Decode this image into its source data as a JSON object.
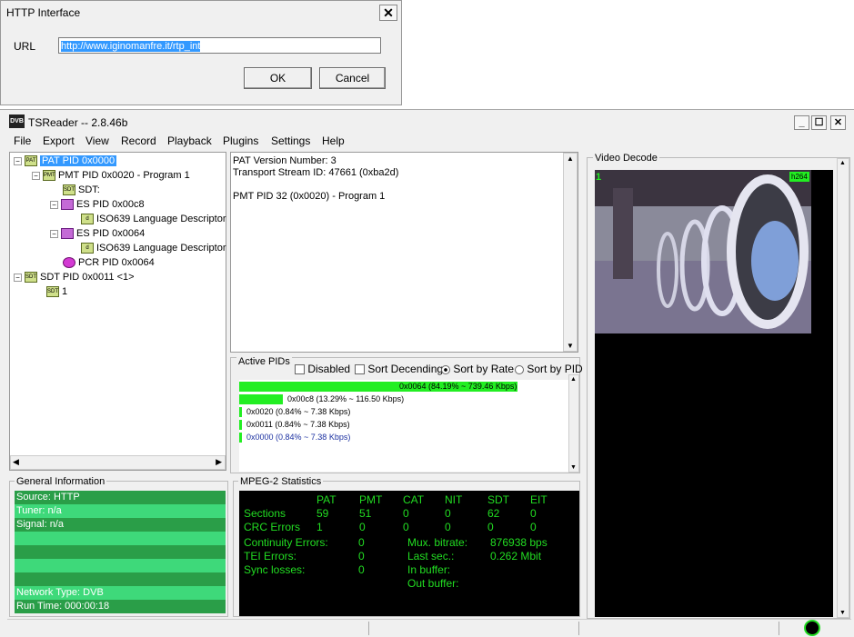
{
  "dialog": {
    "title": "HTTP Interface",
    "url_label": "URL",
    "url_value": "http://www.iginomanfre.it/rtp_int",
    "ok_label": "OK",
    "cancel_label": "Cancel"
  },
  "window": {
    "title": "TSReader -- 2.8.46b",
    "app_icon_text": "DVB"
  },
  "menu": [
    "File",
    "Export",
    "View",
    "Record",
    "Playback",
    "Plugins",
    "Settings",
    "Help"
  ],
  "tree": [
    {
      "label": "PAT PID 0x0000",
      "icon": "PAT"
    },
    {
      "label": "PMT PID 0x0020 - Program 1",
      "icon": "PMT"
    },
    {
      "label": "SDT:",
      "icon": "SDT"
    },
    {
      "label": "ES PID 0x00c8",
      "icon": "video"
    },
    {
      "label": "ISO639 Language Descriptor",
      "icon": "descriptor"
    },
    {
      "label": "ES PID 0x0064",
      "icon": "audio"
    },
    {
      "label": "ISO639 Language Descriptor",
      "icon": "descriptor"
    },
    {
      "label": "PCR PID 0x0064",
      "icon": "pcr"
    },
    {
      "label": "SDT PID 0x0011 <1>",
      "icon": "SDT"
    },
    {
      "label": "1",
      "icon": "SDT"
    }
  ],
  "details": {
    "line1": "PAT Version Number: 3",
    "line2": "Transport Stream ID: 47661 (0xba2d)",
    "line3": "PMT PID 32 (0x0020) - Program 1"
  },
  "active_pids": {
    "title": "Active PIDs",
    "disabled_label": "Disabled",
    "sort_desc_label": "Sort Decending",
    "sort_rate_label": "Sort by Rate",
    "sort_pid_label": "Sort by PID",
    "rows": [
      {
        "text": "0x0064 (84.19% ~ 739.46 Kbps)",
        "fraction": 0.8419
      },
      {
        "text": "0x00c8 (13.29% ~ 116.50 Kbps)",
        "fraction": 0.1329
      },
      {
        "text": "0x0020 (0.84% ~ 7.38 Kbps)",
        "fraction": 0.0084
      },
      {
        "text": "0x0011 (0.84% ~ 7.38 Kbps)",
        "fraction": 0.0084
      },
      {
        "text": "0x0000 (0.84% ~ 7.38 Kbps)",
        "fraction": 0.0084
      }
    ]
  },
  "video": {
    "title": "Video Decode",
    "frame_num": "1",
    "codec_badge": "h264"
  },
  "general_info": {
    "title": "General Information",
    "source": "Source: HTTP",
    "tuner": "Tuner: n/a",
    "signal": "Signal: n/a",
    "network_type": "Network Type: DVB",
    "run_time": "Run Time: 000:00:18"
  },
  "mpeg2": {
    "title": "MPEG-2 Statistics",
    "cols": [
      "PAT",
      "PMT",
      "CAT",
      "NIT",
      "SDT",
      "EIT"
    ],
    "sections_label": "Sections",
    "sections": [
      "59",
      "51",
      "0",
      "0",
      "62",
      "0"
    ],
    "crc_label": "CRC Errors",
    "crc": [
      "1",
      "0",
      "0",
      "0",
      "0",
      "0"
    ],
    "continuity_label": "Continuity Errors:",
    "continuity": "0",
    "tei_label": "TEI Errors:",
    "tei": "0",
    "sync_label": "Sync losses:",
    "sync": "0",
    "mux_label": "Mux. bitrate:",
    "mux": "876938 bps",
    "last_label": "Last sec.:",
    "last": "0.262 Mbit",
    "inbuf_label": "In buffer:",
    "outbuf_label": "Out buffer:"
  },
  "colors": {
    "stat_green": "#22dd22",
    "pid_bar": "#22ee22",
    "info_green": "#33bb55",
    "selection": "#3399ff"
  }
}
